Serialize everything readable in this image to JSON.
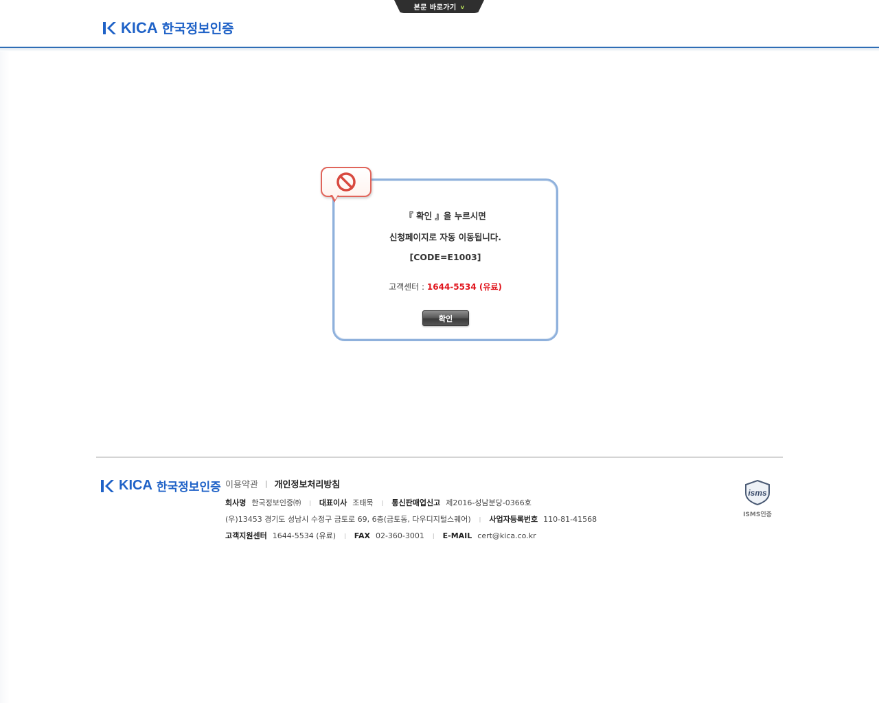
{
  "skip_link": {
    "label": "본문 바로가기",
    "arrow": "v"
  },
  "brand": {
    "latin": "KICA",
    "korean": "한국정보인증",
    "color": "#1f62c7"
  },
  "dialog": {
    "icon": "no-entry-icon",
    "line1": "『 확인 』을 누르시면",
    "line2": "신청페이지로 자동 이동됩니다.",
    "code": "[CODE=E1003]",
    "support_label": "고객센터 : ",
    "support_phone": "1644-5534 (유료)",
    "ok_label": "확인",
    "border_color": "#8fb1dc",
    "accent_color": "#e0141c"
  },
  "footer": {
    "terms_label": "이용약관",
    "privacy_label": "개인정보처리방침",
    "row1": {
      "company_label": "회사명",
      "company_value": "한국정보인증㈜",
      "ceo_label": "대표이사",
      "ceo_value": "조태묵",
      "ecommerce_label": "통신판매업신고",
      "ecommerce_value": "제2016-성남분당-0366호"
    },
    "row2": {
      "address_value": "(우)13453 경기도 성남시 수정구 금토로 69, 6층(금토동, 다우디지털스퀘어)",
      "bizno_label": "사업자등록번호",
      "bizno_value": "110-81-41568"
    },
    "row3": {
      "support_label": "고객지원센터",
      "support_value": "1644-5534 (유료)",
      "fax_label": "FAX",
      "fax_value": "02-360-3001",
      "email_label": "E-MAIL",
      "email_value": "cert@kica.co.kr"
    },
    "isms": {
      "badge_text": "isms",
      "caption": "ISMS인증"
    }
  }
}
